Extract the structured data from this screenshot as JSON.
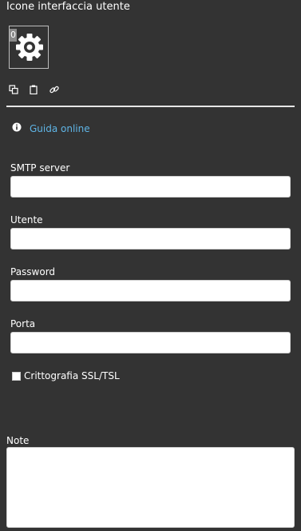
{
  "section": {
    "title": "Icone interfaccia utente"
  },
  "icon_tile": {
    "badge": "0",
    "icon": "gear-icon"
  },
  "tools": [
    {
      "icon": "copy-icon"
    },
    {
      "icon": "paste-icon"
    },
    {
      "icon": "link-icon"
    }
  ],
  "help": {
    "icon": "info-icon",
    "label": "Guida online"
  },
  "fields": {
    "smtp": {
      "label": "SMTP server",
      "value": "",
      "placeholder": ""
    },
    "user": {
      "label": "Utente",
      "value": "",
      "placeholder": ""
    },
    "password": {
      "label": "Password",
      "value": "",
      "placeholder": ""
    },
    "port": {
      "label": "Porta",
      "value": "",
      "placeholder": ""
    }
  },
  "ssl": {
    "label": "Crittografia SSL/TSL",
    "checked": false
  },
  "notes": {
    "label": "Note",
    "value": ""
  },
  "colors": {
    "background": "#333333",
    "link": "#5fb5e6",
    "badge": "#8a8a8a"
  }
}
